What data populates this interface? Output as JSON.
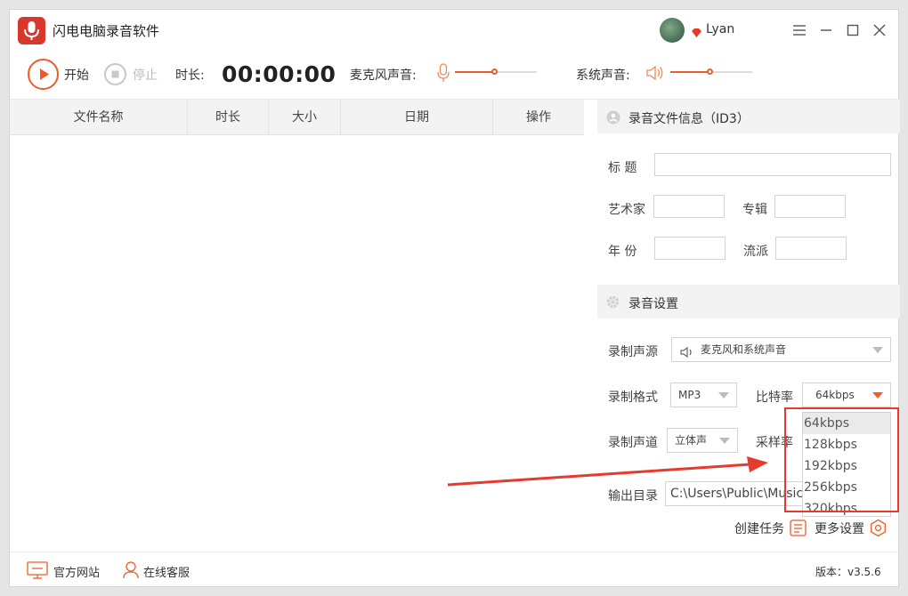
{
  "app": {
    "title": "闪电电脑录音软件",
    "username": "Lyan"
  },
  "toolbar": {
    "start_label": "开始",
    "stop_label": "停止",
    "duration_label": "时长:",
    "timer": "00:00:00",
    "mic_label": "麦克风声音:",
    "system_label": "系统声音:",
    "mic_volume_fraction": 0.5,
    "system_volume_fraction": 0.5
  },
  "table": {
    "columns": [
      "文件名称",
      "时长",
      "大小",
      "日期",
      "操作"
    ]
  },
  "id3": {
    "title": "录音文件信息（ID3）",
    "title_label": "标  题",
    "artist_label": "艺术家",
    "album_label": "专辑",
    "year_label": "年  份",
    "genre_label": "流派"
  },
  "settings": {
    "title": "录音设置",
    "source_label": "录制声源",
    "source_value": "麦克风和系统声音",
    "format_label": "录制格式",
    "format_value": "MP3",
    "bitrate_label": "比特率",
    "bitrate_value": "64kbps",
    "channel_label": "录制声道",
    "channel_value": "立体声",
    "samplerate_label": "采样率",
    "output_label": "输出目录",
    "output_value": "C:\\Users\\Public\\Music\\",
    "bitrate_options": [
      "64kbps",
      "128kbps",
      "192kbps",
      "256kbps",
      "320kbps"
    ],
    "create_task_label": "创建任务",
    "more_settings_label": "更多设置"
  },
  "footer": {
    "website_label": "官方网站",
    "support_label": "在线客服",
    "version": "版本：v3.5.6"
  },
  "colors": {
    "accent": "#ef5b28",
    "annotation_red": "#e63a2e",
    "logo_red": "#d9362c"
  }
}
